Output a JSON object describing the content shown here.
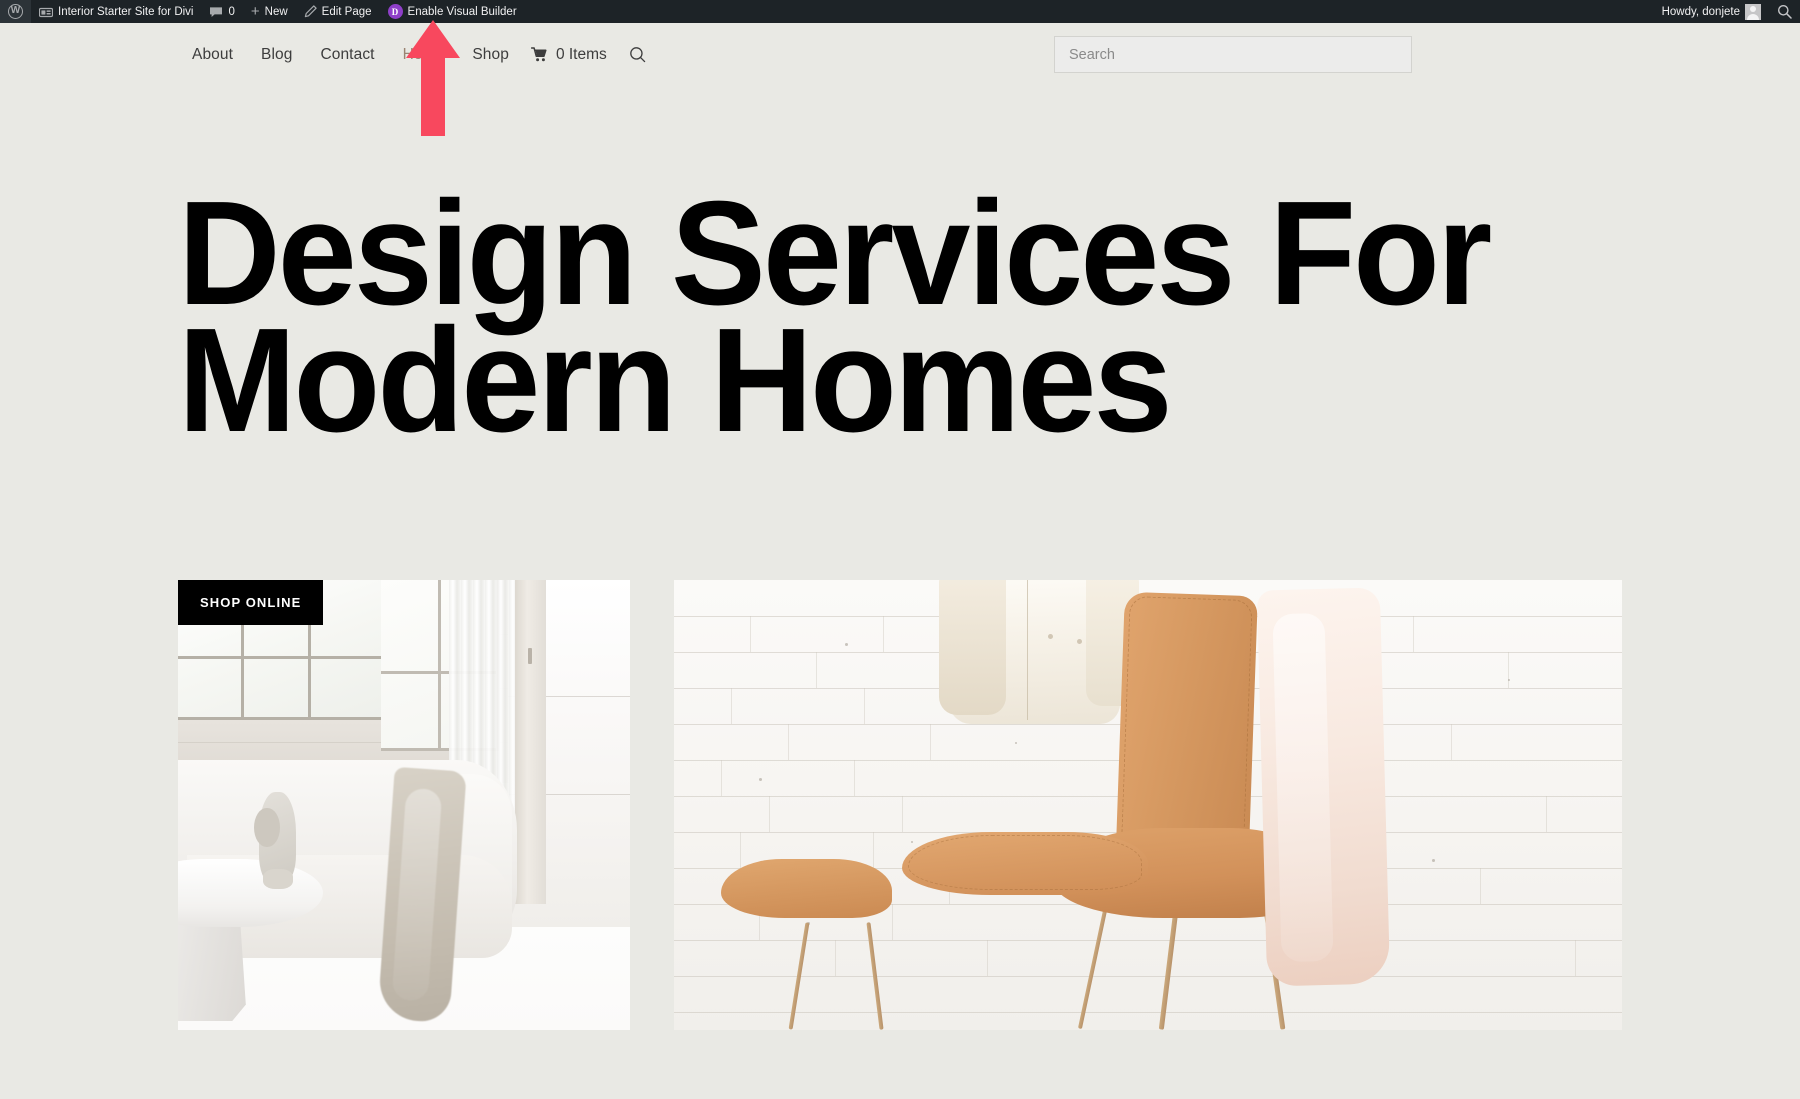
{
  "admin_bar": {
    "wp_logo_icon": "wordpress-logo-icon",
    "site_name": "Interior Starter Site for Divi",
    "site_icon": "dashboard-site-icon",
    "comments_icon": "comment-bubble-icon",
    "comments_count": "0",
    "new_icon": "plus-icon",
    "new_label": "New",
    "edit_icon": "pencil-icon",
    "edit_label": "Edit Page",
    "divi_badge": "D",
    "divi_label": "Enable Visual Builder",
    "howdy_label": "Howdy, donjete",
    "avatar_icon": "user-avatar-icon",
    "search_icon": "search-icon"
  },
  "header": {
    "nav_items": [
      {
        "label": "About",
        "active": false
      },
      {
        "label": "Blog",
        "active": false
      },
      {
        "label": "Contact",
        "active": false
      },
      {
        "label": "Home",
        "active": true
      },
      {
        "label": "Shop",
        "active": false
      }
    ],
    "cart_icon": "shopping-cart-icon",
    "cart_count_label": "0 Items",
    "nav_search_icon": "search-icon",
    "search_placeholder": "Search",
    "search_value": ""
  },
  "hero": {
    "heading": "Design Services For\nModern Homes"
  },
  "gallery": {
    "shop_online_label": "SHOP ONLINE",
    "left_image_alt": "white-curved-sofa-marble-table-room",
    "right_image_alt": "tan-leather-butterfly-chairs-brick-wall"
  },
  "annotation": {
    "arrow_icon": "up-arrow-annotation",
    "arrow_color": "#f8485e"
  },
  "colors": {
    "page_background": "#e9e9e4",
    "admin_bar_background": "#1d2327",
    "admin_bar_text": "#f0f0f1",
    "nav_text": "#3d3d3d",
    "nav_active_text": "#9a8472",
    "heading_text": "#000000",
    "tag_background": "#000000",
    "tag_text": "#ffffff",
    "divi_purple": "#8f3fc9",
    "annotation_red": "#f8485e"
  }
}
